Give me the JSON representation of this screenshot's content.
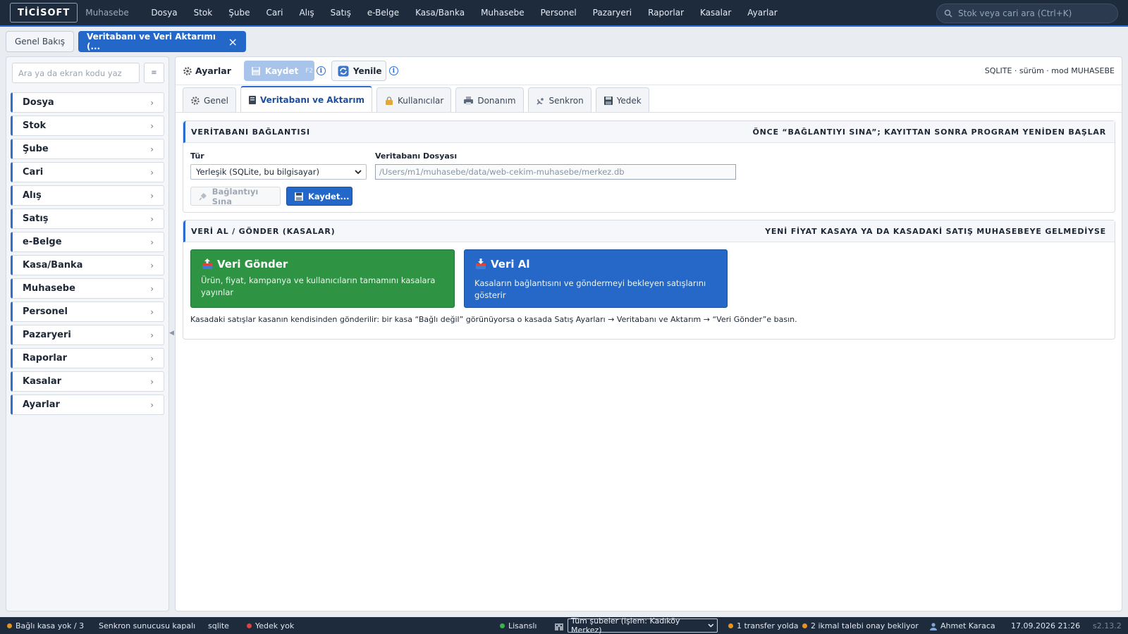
{
  "topbar": {
    "brand": "TİCİSOFT",
    "brand_sub": "Muhasebe",
    "nav": [
      "Dosya",
      "Stok",
      "Şube",
      "Cari",
      "Alış",
      "Satış",
      "e-Belge",
      "Kasa/Banka",
      "Muhasebe",
      "Personel",
      "Pazaryeri",
      "Raporlar",
      "Kasalar",
      "Ayarlar"
    ],
    "search_placeholder": "Stok veya cari ara (Ctrl+K)"
  },
  "tabs": {
    "overview": "Genel Bakış",
    "active": "Veritabanı ve Veri Aktarımı (...",
    "close": "×"
  },
  "sidebar": {
    "search_placeholder": "Ara ya da ekran kodu yaz",
    "menu_icon": "≡",
    "items": [
      {
        "label": "Dosya"
      },
      {
        "label": "Stok"
      },
      {
        "label": "Şube"
      },
      {
        "label": "Cari"
      },
      {
        "label": "Alış"
      },
      {
        "label": "Satış"
      },
      {
        "label": "e-Belge"
      },
      {
        "label": "Kasa/Banka"
      },
      {
        "label": "Muhasebe"
      },
      {
        "label": "Personel"
      },
      {
        "label": "Pazaryeri"
      },
      {
        "label": "Raporlar"
      },
      {
        "label": "Kasalar"
      },
      {
        "label": "Ayarlar"
      }
    ],
    "chevron": "›"
  },
  "toolbar": {
    "title": "Ayarlar",
    "save_label": "Kaydet",
    "save_key": "F2",
    "refresh_label": "Yenile",
    "info": "i",
    "right_info": "SQLITE · sürüm · mod MUHASEBE"
  },
  "subtabs": [
    "Genel",
    "Veritabanı ve Aktarım",
    "Kullanıcılar",
    "Donanım",
    "Senkron",
    "Yedek"
  ],
  "db_card": {
    "title": "VERİTABANI BAĞLANTISI",
    "hint": "ÖNCE “BAĞLANTIYI SINA”; KAYITTAN SONRA PROGRAM YENİDEN BAŞLAR",
    "type_label": "Tür",
    "type_value": "Yerleşik (SQLite, bu bilgisayar)",
    "file_label": "Veritabanı Dosyası",
    "file_value": "/Users/m1/muhasebe/data/web-cekim-muhasebe/merkez.db",
    "test_button": "Bağlantıyı Sına",
    "save_button": "Kaydet..."
  },
  "transfer_card": {
    "title": "VERİ AL / GÖNDER (KASALAR)",
    "hint": "YENİ FİYAT KASAYA YA DA KASADAKİ SATIŞ MUHASEBEYE GELMEDİYSE",
    "send_title": "Veri Gönder",
    "send_desc": "Ürün, fiyat, kampanya ve kullanıcıların tamamını kasalara yayınlar",
    "receive_title": "Veri Al",
    "receive_desc": "Kasaların bağlantısını ve göndermeyi bekleyen satışlarını gösterir",
    "note": "Kasadaki satışlar kasanın kendisinden gönderilir: bir kasa “Bağlı değil” görünüyorsa o kasada Satış Ayarları → Veritabanı ve Aktarım → “Veri Gönder”e basın."
  },
  "statusbar": {
    "pos": "Bağlı kasa yok / 3",
    "sync": "Senkron sunucusu kapalı",
    "db": "sqlite",
    "backup": "Yedek yok",
    "license": "Lisanslı",
    "branch_select": "Tüm şubeler (işlem: Kadıköy Merkez)",
    "transfer": "1 transfer yolda",
    "supply": "2 ikmal talebi onay bekliyor",
    "user": "Ahmet Karaca",
    "datetime": "17.09.2026 21:26",
    "version": "s2.13.2"
  },
  "colors": {
    "topbar_bg": "#1e2b3c",
    "accent": "#2368c9",
    "green": "#2e9444",
    "status_orange": "#e8931f",
    "status_red": "#e0413a",
    "status_green": "#3bb34a"
  }
}
